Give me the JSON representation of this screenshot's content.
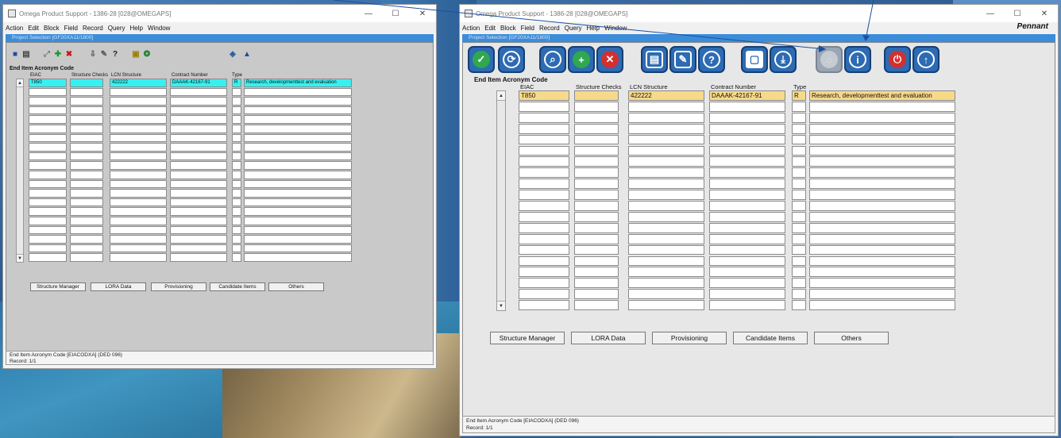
{
  "app_title": "Omega Product Support - 1386-28 [028@OMEGAPS]",
  "menu": [
    "Action",
    "Edit",
    "Block",
    "Field",
    "Record",
    "Query",
    "Help",
    "Window"
  ],
  "brand": "Pennant",
  "inner_title": "Project Selection  [GF20XA11/1800]",
  "section_title": "End Item Acronym Code",
  "columns": {
    "eiac": "EIAC",
    "structure": "Structure Checks",
    "lcn": "LCN Structure",
    "contract": "Contract Number",
    "type": "Type"
  },
  "row": {
    "eiac": "T850",
    "structure": "",
    "lcn": "422222",
    "contract": "DAAAK-42167-91",
    "type": "R",
    "description": "Research, developmenttest and evaluation"
  },
  "buttons": [
    "Structure Manager",
    "LORA Data",
    "Provisioning",
    "Candidate Items",
    "Others"
  ],
  "status_line1": "End Item Acronym Code [EIACODXA] (DED 096)",
  "status_line2": "Record: 1/1",
  "toolbar_icons": [
    "check",
    "sync",
    "search",
    "add",
    "delete",
    "print",
    "edit",
    "help",
    "copy",
    "save",
    "exit",
    "info",
    "close",
    "up"
  ]
}
